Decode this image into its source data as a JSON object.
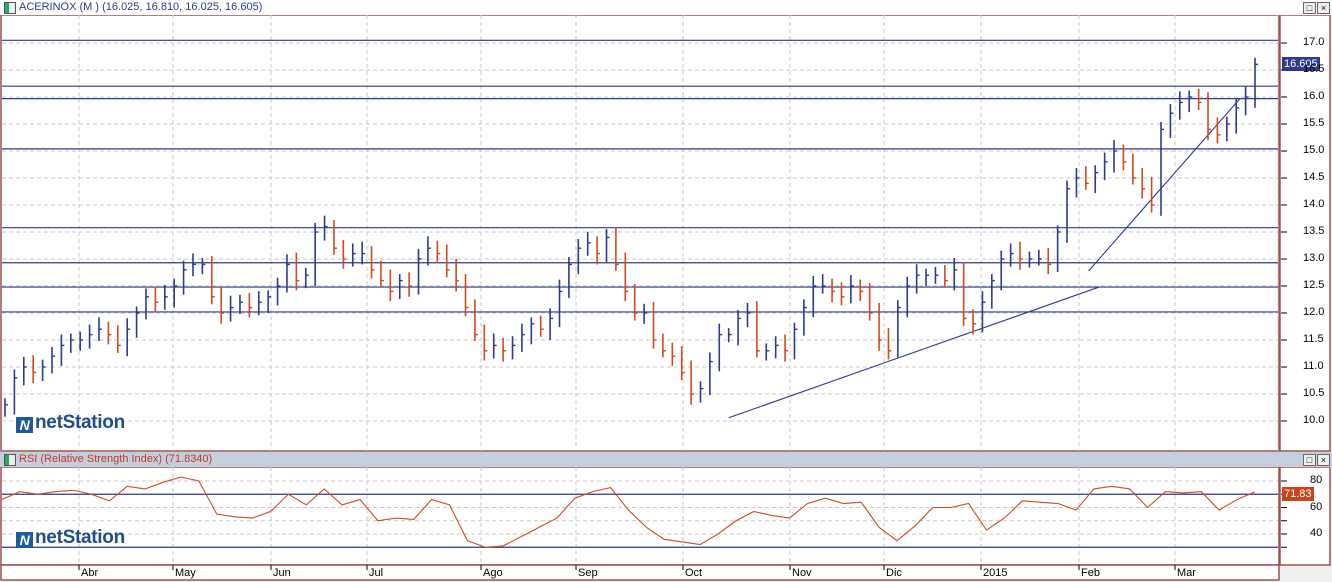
{
  "main_panel": {
    "title": "ACERINOX (M ) (16.025, 16.810, 16.025, 16.605)",
    "last_price_tag": "16.605",
    "logo_text": "netStation"
  },
  "rsi_panel": {
    "title": "RSI (Relative Strength Index) (71.8340)",
    "last_value_tag": "71.83",
    "logo_text": "netStation"
  },
  "window_buttons": {
    "maximize": "□",
    "close": "×"
  },
  "colors": {
    "up": "#2e3a8c",
    "down": "#d04a1e",
    "rsi_line": "#d04a1e",
    "level": "#2e3a8c",
    "tag_price": "#2e3a8c",
    "tag_rsi": "#c8441a",
    "border": "#a05050"
  },
  "chart_data": [
    {
      "type": "ohlc-bar",
      "title": "ACERINOX",
      "ylim": [
        9.7,
        17.5
      ],
      "yticks": [
        "10.0",
        "10.5",
        "11.0",
        "11.5",
        "12.0",
        "12.5",
        "13.0",
        "13.5",
        "14.0",
        "14.5",
        "15.0",
        "15.5",
        "16.0",
        "16.5",
        "17.0"
      ],
      "x_months": [
        "Abr",
        "May",
        "Jun",
        "Jul",
        "Ago",
        "Sep",
        "Oct",
        "Nov",
        "Dic",
        "2015",
        "Feb",
        "Mar"
      ],
      "closes": [
        10.3,
        10.8,
        11.0,
        10.9,
        11.0,
        11.2,
        11.4,
        11.5,
        11.5,
        11.6,
        11.7,
        11.6,
        11.4,
        11.7,
        12.0,
        12.3,
        12.2,
        12.3,
        12.5,
        12.8,
        12.9,
        12.9,
        12.3,
        12.0,
        12.1,
        12.2,
        12.1,
        12.2,
        12.3,
        12.5,
        12.9,
        12.6,
        12.7,
        13.5,
        13.6,
        13.2,
        13.0,
        13.1,
        13.1,
        12.8,
        12.6,
        12.4,
        12.6,
        12.5,
        13.0,
        13.2,
        13.1,
        12.8,
        12.6,
        12.1,
        11.6,
        11.3,
        11.4,
        11.3,
        11.4,
        11.6,
        11.8,
        11.7,
        11.9,
        12.4,
        12.9,
        13.2,
        13.3,
        13.1,
        13.4,
        12.9,
        12.4,
        12.0,
        12.0,
        11.5,
        11.3,
        11.2,
        10.9,
        10.5,
        10.6,
        11.1,
        11.6,
        11.6,
        11.9,
        12.0,
        11.3,
        11.3,
        11.4,
        11.3,
        11.7,
        12.1,
        12.5,
        12.5,
        12.4,
        12.3,
        12.5,
        12.4,
        12.0,
        11.5,
        11.3,
        12.1,
        12.5,
        12.7,
        12.7,
        12.7,
        12.6,
        12.8,
        11.9,
        11.8,
        12.2,
        12.6,
        13.0,
        13.1,
        13.0,
        13.0,
        13.0,
        12.9,
        13.5,
        14.3,
        14.5,
        14.4,
        14.6,
        14.8,
        15.0,
        14.8,
        14.5,
        14.3,
        14.0,
        15.4,
        15.7,
        15.9,
        16.0,
        15.9,
        15.4,
        15.3,
        15.5,
        15.8,
        16.0,
        16.605
      ],
      "levels": [
        17.05,
        16.2,
        15.97,
        15.04,
        13.58,
        12.93,
        12.48,
        12.02
      ],
      "trendlines": [
        {
          "from": {
            "bar": 77,
            "price": 10.06
          },
          "to": {
            "bar": 116.4,
            "price": 12.48
          }
        },
        {
          "from": {
            "bar": 115.3,
            "price": 12.78
          },
          "to": {
            "bar": 131.4,
            "price": 15.97
          }
        }
      ]
    },
    {
      "type": "line",
      "title": "RSI (Relative Strength Index)",
      "ylim": [
        22,
        87
      ],
      "yticks": [
        "40",
        "60",
        "80"
      ],
      "levels": [
        70,
        30
      ],
      "values": [
        66,
        72,
        70,
        72,
        73,
        70,
        65,
        76,
        74,
        79,
        83,
        80,
        55,
        53,
        52,
        57,
        70,
        62,
        74,
        62,
        66,
        50,
        52,
        51,
        66,
        62,
        35,
        30,
        31,
        38,
        45,
        52,
        67,
        72,
        75,
        58,
        45,
        36,
        34,
        32,
        40,
        50,
        57,
        54,
        52,
        63,
        67,
        63,
        64,
        45,
        35,
        46,
        60,
        60,
        63,
        43,
        52,
        65,
        64,
        63,
        58,
        74,
        76,
        74,
        60,
        72,
        71,
        72,
        58,
        66,
        71.83
      ]
    }
  ]
}
